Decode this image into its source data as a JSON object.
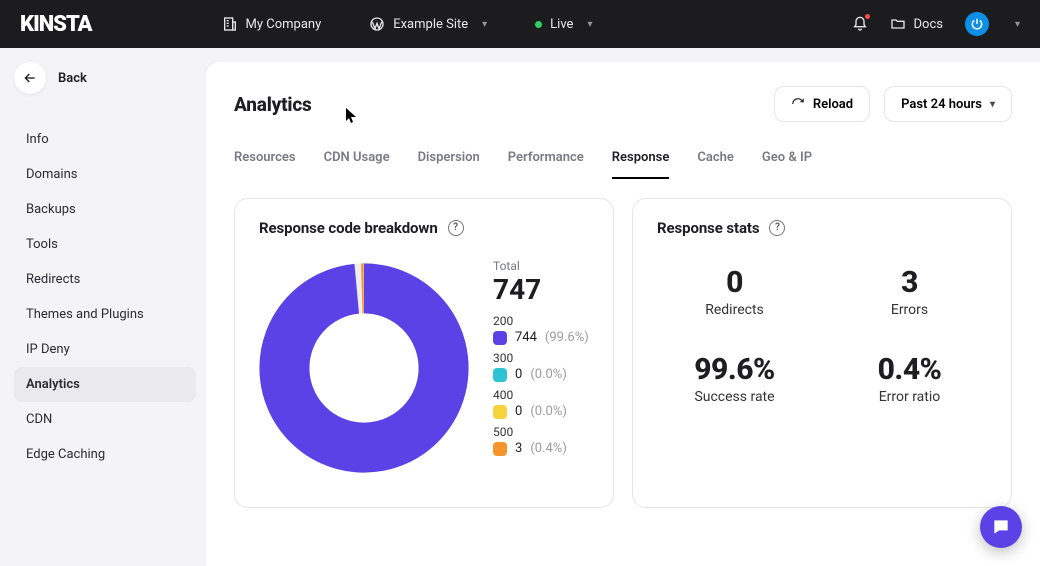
{
  "topbar": {
    "brand": "KINSTA",
    "company": "My Company",
    "site": "Example Site",
    "env": "Live",
    "docs": "Docs"
  },
  "back_label": "Back",
  "sidebar": {
    "items": [
      {
        "label": "Info"
      },
      {
        "label": "Domains"
      },
      {
        "label": "Backups"
      },
      {
        "label": "Tools"
      },
      {
        "label": "Redirects"
      },
      {
        "label": "Themes and Plugins"
      },
      {
        "label": "IP Deny"
      },
      {
        "label": "Analytics"
      },
      {
        "label": "CDN"
      },
      {
        "label": "Edge Caching"
      }
    ],
    "active": "Analytics"
  },
  "page": {
    "title": "Analytics",
    "reload": "Reload",
    "range": "Past 24 hours",
    "tabs": [
      "Resources",
      "CDN Usage",
      "Dispersion",
      "Performance",
      "Response",
      "Cache",
      "Geo & IP"
    ],
    "active_tab": "Response"
  },
  "breakdown": {
    "title": "Response code breakdown",
    "total_label": "Total",
    "total": "747",
    "rows": [
      {
        "code": "200",
        "count": "744",
        "pct": "(99.6%)",
        "sw": "purple"
      },
      {
        "code": "300",
        "count": "0",
        "pct": "(0.0%)",
        "sw": "teal"
      },
      {
        "code": "400",
        "count": "0",
        "pct": "(0.0%)",
        "sw": "yellow"
      },
      {
        "code": "500",
        "count": "3",
        "pct": "(0.4%)",
        "sw": "orange"
      }
    ]
  },
  "stats": {
    "title": "Response stats",
    "items": [
      {
        "value": "0",
        "label": "Redirects"
      },
      {
        "value": "3",
        "label": "Errors"
      },
      {
        "value": "99.6%",
        "label": "Success rate"
      },
      {
        "value": "0.4%",
        "label": "Error ratio"
      }
    ]
  },
  "chart_data": {
    "type": "pie",
    "title": "Response code breakdown",
    "categories": [
      "200",
      "300",
      "400",
      "500"
    ],
    "values": [
      744,
      0,
      0,
      3
    ],
    "colors": [
      "#5b42e7",
      "#2ec4d4",
      "#f5d33a",
      "#f5942a"
    ],
    "total": 747
  }
}
